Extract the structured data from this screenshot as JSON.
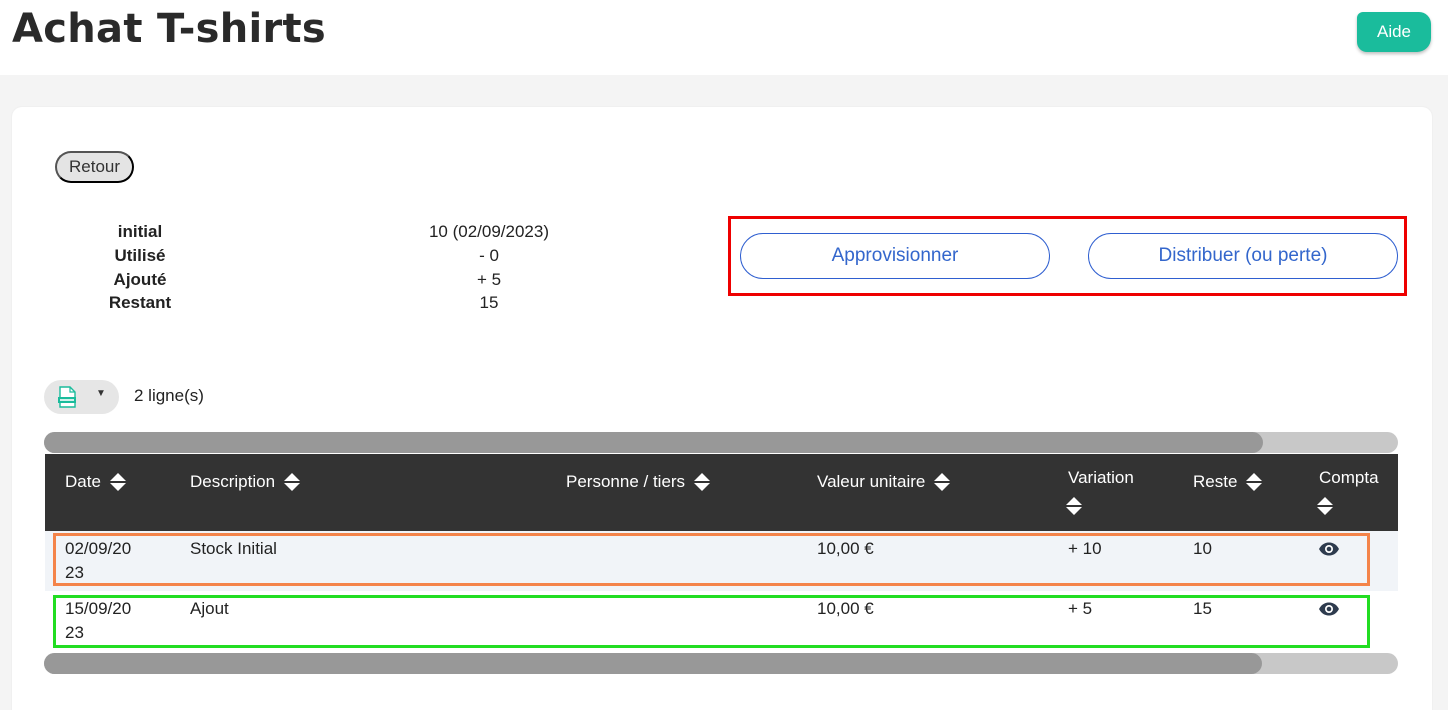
{
  "header": {
    "title": "Achat T-shirts",
    "help_label": "Aide"
  },
  "back_label": "Retour",
  "summary": [
    {
      "label": "initial",
      "value": "10 (02/09/2023)"
    },
    {
      "label": "Utilisé",
      "value": "- 0"
    },
    {
      "label": "Ajouté",
      "value": "+ 5"
    },
    {
      "label": "Restant",
      "value": "15"
    }
  ],
  "actions": {
    "supply_label": "Approvisionner",
    "distribute_label": "Distribuer (ou perte)"
  },
  "toolbar": {
    "export_icon": "xlsx-file-icon",
    "row_count": "2 ligne(s)"
  },
  "table": {
    "columns": [
      "Date",
      "Description",
      "Personne / tiers",
      "Valeur unitaire",
      "Variation",
      "Reste",
      "Compta"
    ],
    "rows": [
      {
        "date_l1": "02/09/20",
        "date_l2": "23",
        "description": "Stock Initial",
        "person": "",
        "unit_value": "10,00 €",
        "variation": "+ 10",
        "remaining": "10",
        "compta_icon": "eye-icon"
      },
      {
        "date_l1": "15/09/20",
        "date_l2": "23",
        "description": "Ajout",
        "person": "",
        "unit_value": "10,00 €",
        "variation": "+ 5",
        "remaining": "15",
        "compta_icon": "eye-icon"
      }
    ]
  },
  "colors": {
    "accent": "#1abc9c",
    "link": "#3366cc",
    "highlight_actions": "#ee0000",
    "highlight_row1": "#f4844a",
    "highlight_row2": "#22dd22",
    "table_header": "#333333"
  }
}
